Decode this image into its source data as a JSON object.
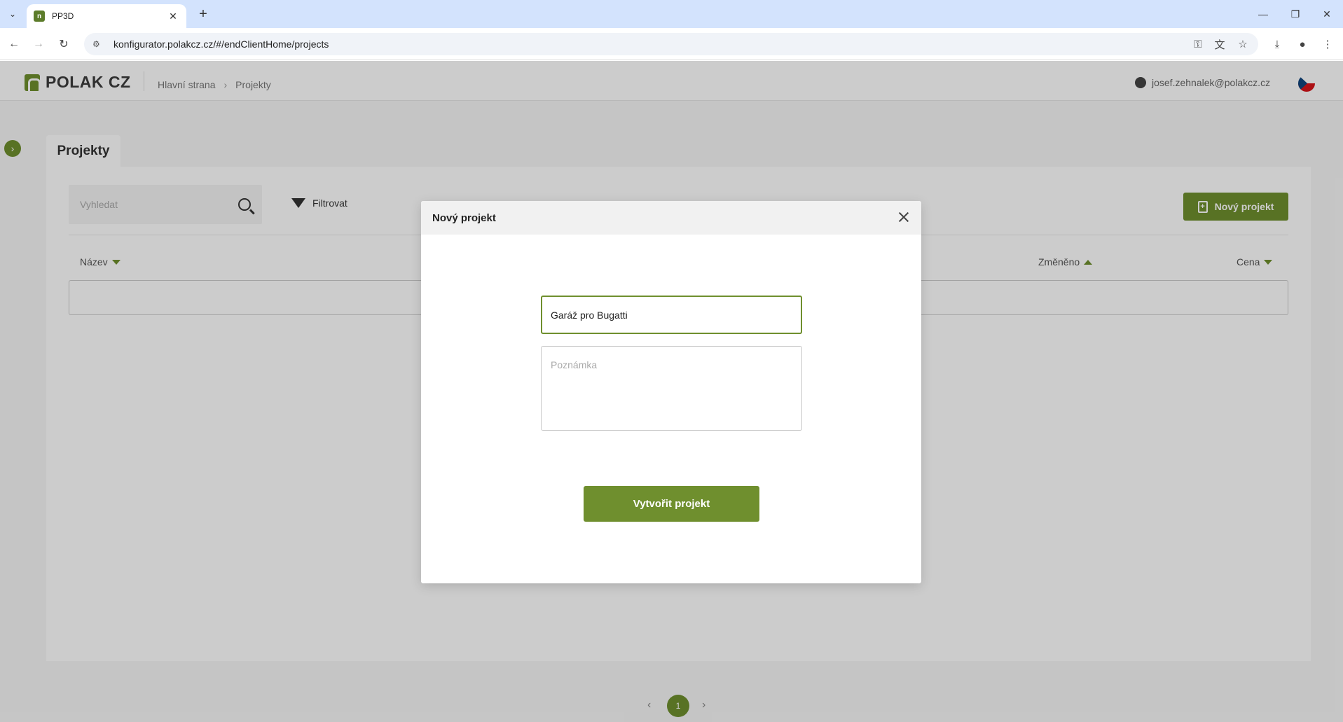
{
  "browser": {
    "tab_title": "PP3D",
    "url": "konfigurator.polakcz.cz/#/endClientHome/projects"
  },
  "app": {
    "logo_text": "POLAK CZ",
    "breadcrumb": [
      "Hlavní strana",
      "Projekty"
    ],
    "user_email": "josef.zehnalek@polakcz.cz"
  },
  "page": {
    "tab_label": "Projekty",
    "search_placeholder": "Vyhledat",
    "filter_label": "Filtrovat",
    "new_project_label": "Nový projekt",
    "columns": {
      "name": "Název",
      "changed": "Změněno",
      "price": "Cena"
    },
    "pagination": {
      "current": "1"
    }
  },
  "modal": {
    "title": "Nový projekt",
    "name_value": "Garáž pro Bugatti",
    "note_placeholder": "Poznámka",
    "create_label": "Vytvořit projekt"
  },
  "colors": {
    "brand": "#6f8f2e"
  }
}
